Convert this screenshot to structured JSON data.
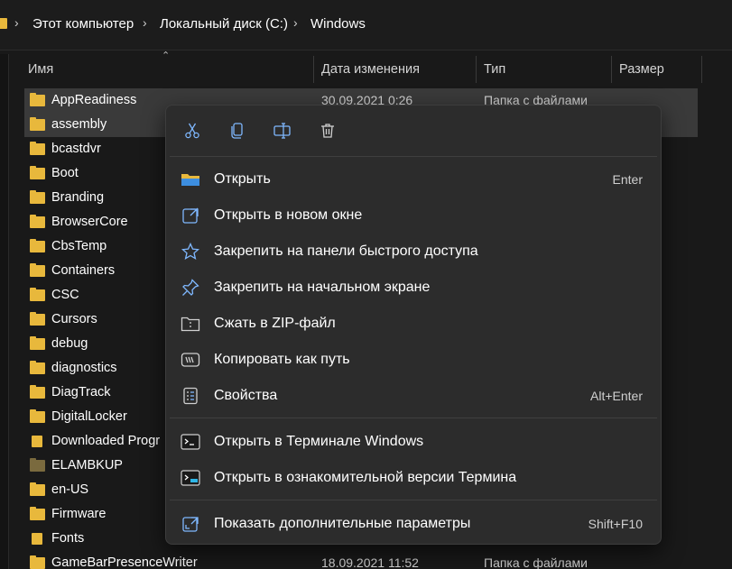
{
  "breadcrumb": {
    "items": [
      "Этот компьютер",
      "Локальный диск (C:)",
      "Windows"
    ],
    "separator": ">"
  },
  "columns": {
    "name": "Имя",
    "date": "Дата изменения",
    "type": "Тип",
    "size": "Размер"
  },
  "files": [
    {
      "name": "AppReadiness",
      "date": "30.09.2021 0:26",
      "type": "Папка с файлами",
      "icon": "folder-icon",
      "selected": true
    },
    {
      "name": "assembly",
      "date": "",
      "type": "",
      "icon": "folder-icon",
      "selected": true
    },
    {
      "name": "bcastdvr",
      "date": "",
      "type": "",
      "icon": "folder-icon"
    },
    {
      "name": "Boot",
      "date": "",
      "type": "",
      "icon": "folder-icon"
    },
    {
      "name": "Branding",
      "date": "",
      "type": "",
      "icon": "folder-icon"
    },
    {
      "name": "BrowserCore",
      "date": "",
      "type": "",
      "icon": "folder-icon"
    },
    {
      "name": "CbsTemp",
      "date": "",
      "type": "",
      "icon": "folder-icon"
    },
    {
      "name": "Containers",
      "date": "",
      "type": "",
      "icon": "folder-icon"
    },
    {
      "name": "CSC",
      "date": "",
      "type": "",
      "icon": "folder-icon"
    },
    {
      "name": "Cursors",
      "date": "",
      "type": "",
      "icon": "folder-icon"
    },
    {
      "name": "debug",
      "date": "",
      "type": "",
      "icon": "folder-icon"
    },
    {
      "name": "diagnostics",
      "date": "",
      "type": "",
      "icon": "folder-icon"
    },
    {
      "name": "DiagTrack",
      "date": "",
      "type": "",
      "icon": "folder-icon"
    },
    {
      "name": "DigitalLocker",
      "date": "",
      "type": "",
      "icon": "folder-icon"
    },
    {
      "name": "Downloaded Progr",
      "date": "",
      "type": "",
      "icon": "folder-doc-icon"
    },
    {
      "name": "ELAMBKUP",
      "date": "",
      "type": "",
      "icon": "folder-dim-icon"
    },
    {
      "name": "en-US",
      "date": "",
      "type": "",
      "icon": "folder-icon"
    },
    {
      "name": "Firmware",
      "date": "",
      "type": "",
      "icon": "folder-icon"
    },
    {
      "name": "Fonts",
      "date": "",
      "type": "",
      "icon": "folder-doc-icon"
    },
    {
      "name": "GameBarPresenceWriter",
      "date": "18.09.2021 11:52",
      "type": "Папка с файлами",
      "icon": "folder-icon"
    }
  ],
  "context_menu": {
    "quick_actions": [
      {
        "name": "cut",
        "icon": "scissors-icon",
        "color": "#7fb8ff"
      },
      {
        "name": "copy",
        "icon": "copy-icon",
        "color": "#7fb8ff"
      },
      {
        "name": "rename",
        "icon": "rename-icon",
        "color": "#7fb8ff"
      },
      {
        "name": "delete",
        "icon": "trash-icon",
        "color": "#d0d0d0"
      }
    ],
    "items": [
      {
        "label": "Открыть",
        "shortcut": "Enter",
        "icon": "folder-open-icon"
      },
      {
        "label": "Открыть в новом окне",
        "shortcut": "",
        "icon": "open-new-window-icon"
      },
      {
        "label": "Закрепить на панели быстрого доступа",
        "shortcut": "",
        "icon": "star-icon"
      },
      {
        "label": "Закрепить на начальном экране",
        "shortcut": "",
        "icon": "pin-icon"
      },
      {
        "label": "Сжать в ZIP-файл",
        "shortcut": "",
        "icon": "zip-icon"
      },
      {
        "label": "Копировать как путь",
        "shortcut": "",
        "icon": "copy-path-icon"
      },
      {
        "label": "Свойства",
        "shortcut": "Alt+Enter",
        "icon": "properties-icon"
      },
      {
        "label": "Открыть в Терминале Windows",
        "shortcut": "",
        "icon": "terminal-icon"
      },
      {
        "label": "Открыть в ознакомительной версии Термина",
        "shortcut": "",
        "icon": "terminal-preview-icon"
      },
      {
        "label": "Показать дополнительные параметры",
        "shortcut": "Shift+F10",
        "icon": "more-options-icon"
      }
    ]
  },
  "colors": {
    "folder": "#e8b83c",
    "accent": "#7fb8ff",
    "menu_bg": "#2c2c2c",
    "selected_row": "#3a3a3a"
  }
}
